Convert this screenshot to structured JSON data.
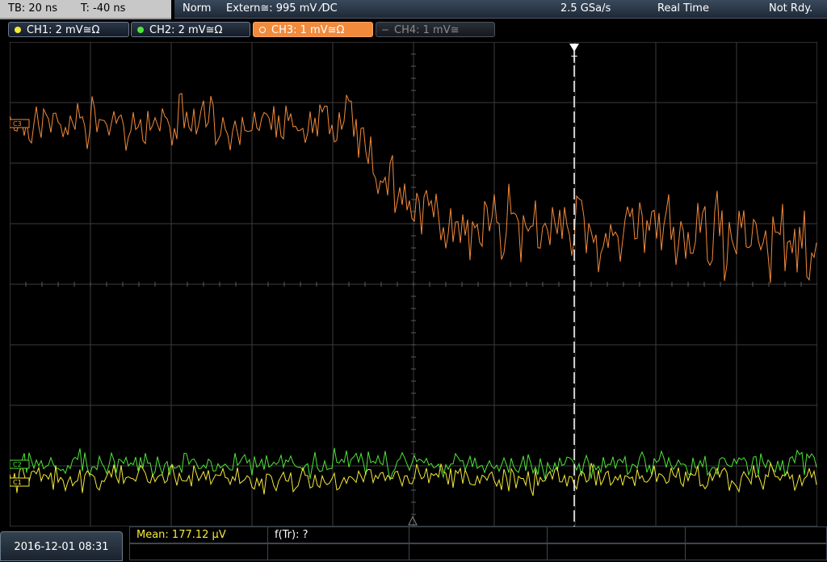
{
  "timebase": {
    "tb_label": "TB: 20 ns",
    "trigger_label": "T: -40 ns"
  },
  "acquisition": {
    "mode": "Norm",
    "trigger_source": "Extern≅: 995 mV ⁄DC",
    "sample_rate": "2.5 GSa/s",
    "acq_type": "Real Time",
    "status": "Not Rdy."
  },
  "channels": [
    {
      "label": "CH1: 2 mV≅Ω",
      "color": "#f4ea3a",
      "state": "on"
    },
    {
      "label": "CH2: 2 mV≅Ω",
      "color": "#4fe43a",
      "state": "on"
    },
    {
      "label": "CH3: 1 mV≅Ω",
      "color": "#f28a3c",
      "state": "active"
    },
    {
      "label": "CH4: 1 mV≅",
      "color": "#7a7a7a",
      "state": "off"
    }
  ],
  "markers": {
    "ch3": "C3",
    "ch2": "C2",
    "ch1": "C1",
    "trigger": "T"
  },
  "statusbar": {
    "datetime": "2016-12-01 08:31",
    "mean": "Mean: 177.12 µV",
    "freq": "f(Tr): ?"
  },
  "colors": {
    "grid": "#5a5a5a",
    "ch1": "#f4ea3a",
    "ch2": "#4fe43a",
    "ch3": "#f28a3c"
  }
}
